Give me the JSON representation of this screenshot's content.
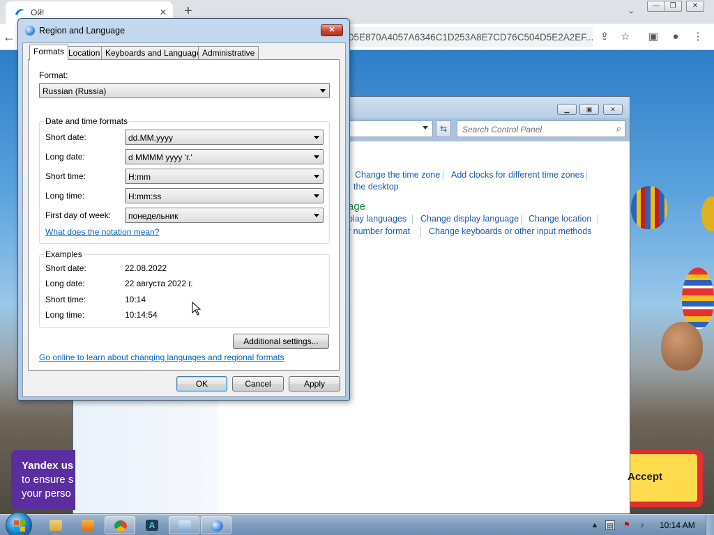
{
  "browser": {
    "tab_title": "Ой!",
    "tab_close": "✕",
    "new_tab": "+",
    "url": "05E870A4057A6346C1D253A8E7CD76C504D5E2A2EF...",
    "window_controls": [
      "—",
      "❐",
      "✕"
    ]
  },
  "control_panel": {
    "search_placeholder": "Search Control Panel",
    "links": {
      "change_time_zone": "Change the time zone",
      "add_clocks": "Add clocks for different time zones",
      "desktop": "the desktop",
      "display_languages": "play languages",
      "change_display_language": "Change display language",
      "change_location": "Change location",
      "number_format": "r number format",
      "change_keyboards": "Change keyboards or other input methods"
    },
    "heading_partial": "age"
  },
  "yandex_banner": {
    "line1": "Yandex us",
    "line2": "to ensure s",
    "line3": "your perso",
    "accept_label": "Accept"
  },
  "dialog": {
    "title": "Region and Language",
    "tabs": [
      "Formats",
      "Location",
      "Keyboards and Languages",
      "Administrative"
    ],
    "format_label": "Format:",
    "format_value": "Russian (Russia)",
    "dt_group_title": "Date and time formats",
    "short_date_label": "Short date:",
    "short_date_value": "dd.MM.yyyy",
    "long_date_label": "Long date:",
    "long_date_value": "d MMMM yyyy 'г.'",
    "short_time_label": "Short time:",
    "short_time_value": "H:mm",
    "long_time_label": "Long time:",
    "long_time_value": "H:mm:ss",
    "first_day_label": "First day of week:",
    "first_day_value": "понедельник",
    "notation_link": "What does the notation mean?",
    "examples_title": "Examples",
    "examples": {
      "short_date_label": "Short date:",
      "short_date": "22.08.2022",
      "long_date_label": "Long date:",
      "long_date": "22 августа 2022 г.",
      "short_time_label": "Short time:",
      "short_time": "10:14",
      "long_time_label": "Long time:",
      "long_time": "10:14:54"
    },
    "additional_settings": "Additional settings...",
    "online_link": "Go online to learn about changing languages and regional formats",
    "ok": "OK",
    "cancel": "Cancel",
    "apply": "Apply"
  },
  "taskbar": {
    "clock": "10:14 AM"
  },
  "colors": {
    "link_blue": "#0066cc",
    "cp_link_blue": "#1a5aa6",
    "yandex_purple": "#5b2ea0",
    "accept_yellow": "#ffdc4e",
    "close_red": "#c9452f"
  }
}
